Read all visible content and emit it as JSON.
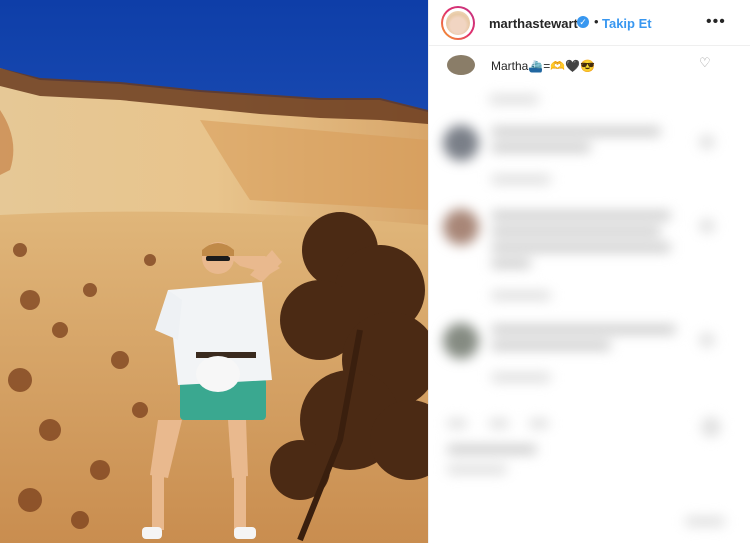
{
  "post": {
    "author": {
      "username": "marthastewart",
      "verified": true,
      "avatar_icon": "profile-avatar"
    },
    "follow_separator": "•",
    "follow_label": "Takip Et",
    "more_icon": "ellipsis-icon",
    "more_label": "•••",
    "first_comment": {
      "text": "Martha⛴️=🫶🖤😎"
    },
    "colors": {
      "accent": "#3897f0",
      "text": "#262626",
      "sky": "#1f4fb8",
      "rock": "#e3c08a"
    }
  }
}
